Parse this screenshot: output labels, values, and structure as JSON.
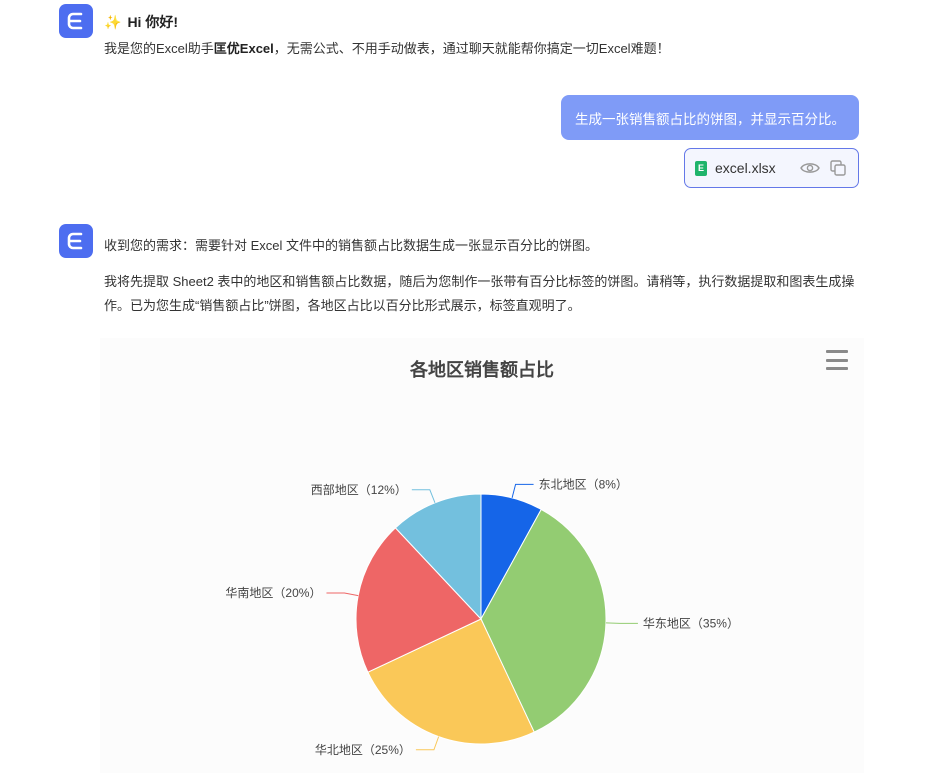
{
  "greeting": {
    "emoji": "✨",
    "title": "Hi 你好!",
    "body_prefix": "我是您的Excel助手",
    "body_brand": "匡优Excel",
    "body_suffix": "，无需公式、不用手动做表，通过聊天就能帮你搞定一切Excel难题！"
  },
  "user_message": {
    "text": "生成一张销售额占比的饼图，并显示百分比。",
    "bubble_color": "#7f9bf7"
  },
  "attachment": {
    "file_name": "excel.xlsx",
    "file_icon": "excel-file-icon",
    "file_icon_letter": "E",
    "actions": [
      "eye-icon",
      "copy-icon"
    ]
  },
  "assistant_reply": {
    "line1": "收到您的需求：需要针对 Excel 文件中的销售额占比数据生成一张显示百分比的饼图。",
    "paragraph": "我将先提取 Sheet2 表中的地区和销售额占比数据，随后为您制作一张带有百分比标签的饼图。请稍等，执行数据提取和图表生成操作。已为您生成“销售额占比”饼图，各地区占比以百分比形式展示，标签直观明了。"
  },
  "chart_data": {
    "type": "pie",
    "title": "各地区销售额占比",
    "slices": [
      {
        "name": "东北地区",
        "value": 8,
        "label": "东北地区（8%）",
        "color": "#1565e8"
      },
      {
        "name": "华东地区",
        "value": 35,
        "label": "华东地区（35%）",
        "color": "#93cc72"
      },
      {
        "name": "华北地区",
        "value": 25,
        "label": "华北地区（25%）",
        "color": "#fac858"
      },
      {
        "name": "华南地区",
        "value": 20,
        "label": "华南地区（20%）",
        "color": "#ee6666"
      },
      {
        "name": "西部地区",
        "value": 12,
        "label": "西部地区（12%）",
        "color": "#73c0de"
      }
    ],
    "start_angle_deg": 90,
    "direction": "clockwise",
    "legend": "none"
  },
  "colors": {
    "brand": "#4d6df0",
    "file_chip_border": "#6478e8"
  }
}
